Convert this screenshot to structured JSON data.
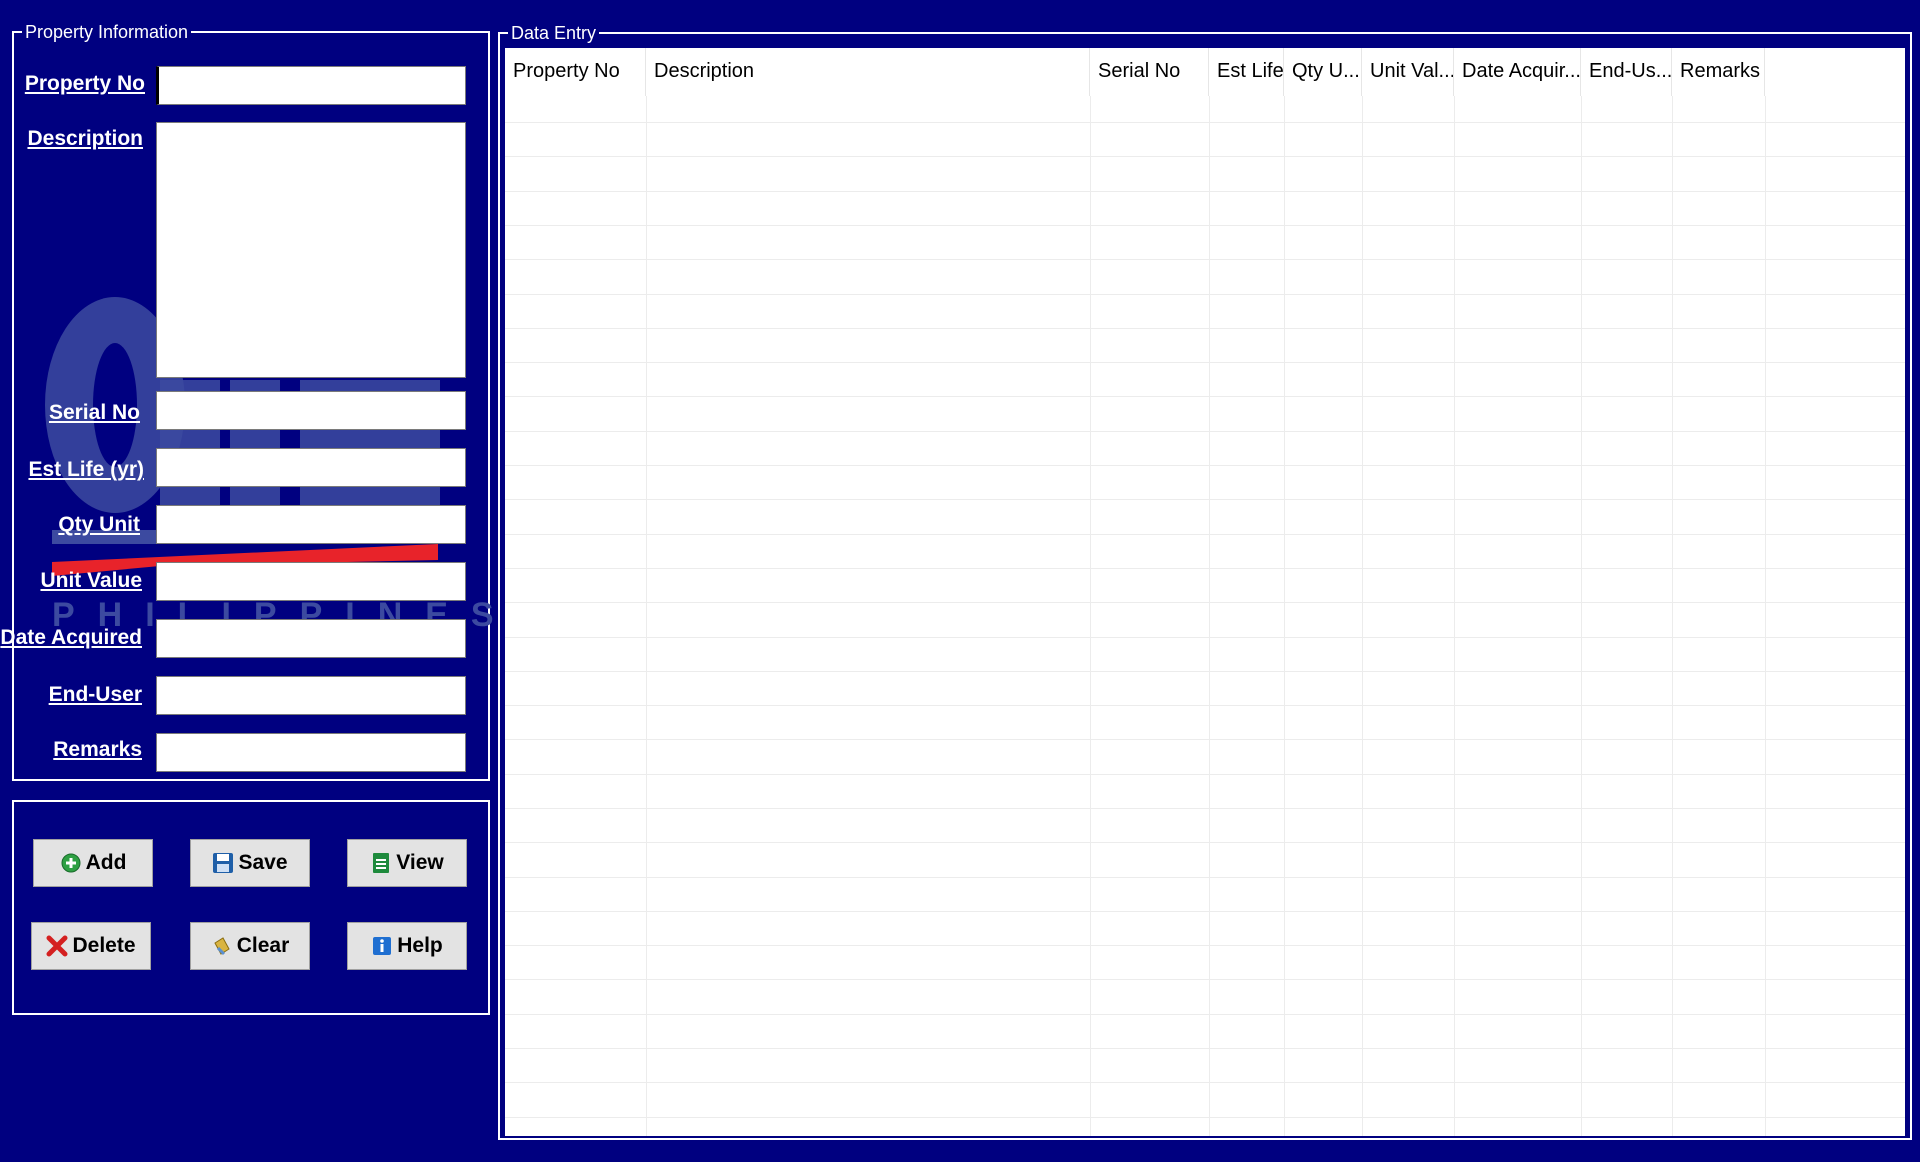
{
  "property_panel": {
    "legend": "Property Information",
    "fields": [
      {
        "key": "property_no",
        "label": "Property No",
        "value": ""
      },
      {
        "key": "description",
        "label": "Description",
        "value": ""
      },
      {
        "key": "serial_no",
        "label": "Serial No",
        "value": ""
      },
      {
        "key": "est_life",
        "label": "Est Life (yr)",
        "value": ""
      },
      {
        "key": "qty_unit",
        "label": "Qty Unit",
        "value": ""
      },
      {
        "key": "unit_value",
        "label": "Unit Value",
        "value": ""
      },
      {
        "key": "date_acquired",
        "label": "Date Acquired",
        "value": ""
      },
      {
        "key": "end_user",
        "label": "End-User",
        "value": ""
      },
      {
        "key": "remarks",
        "label": "Remarks",
        "value": ""
      }
    ],
    "watermark": {
      "letters": "PHILIPPINES",
      "color": "#3c4aa0",
      "accent": "#e8232a"
    }
  },
  "buttons": {
    "add": {
      "label": "Add",
      "icon": "add-circle-icon",
      "color": "#2ea043"
    },
    "save": {
      "label": "Save",
      "icon": "floppy-disk-icon",
      "color": "#1f5fa8"
    },
    "view": {
      "label": "View",
      "icon": "spreadsheet-icon",
      "color": "#1e8a3c"
    },
    "delete": {
      "label": "Delete",
      "icon": "red-x-icon",
      "color": "#d42020"
    },
    "clear": {
      "label": "Clear",
      "icon": "eraser-icon",
      "color": "#d9b441"
    },
    "help": {
      "label": "Help",
      "icon": "info-icon",
      "color": "#1f6fd1"
    }
  },
  "data_entry": {
    "legend": "Data Entry",
    "columns": [
      "Property No",
      "Description",
      "Serial No",
      "Est Life",
      "Qty U...",
      "Unit Val...",
      "Date Acquir...",
      "End-Us...",
      "Remarks"
    ],
    "rows": []
  },
  "colors": {
    "background": "#000080",
    "panel_border": "#ffffff",
    "grid_line": "#ececec"
  }
}
